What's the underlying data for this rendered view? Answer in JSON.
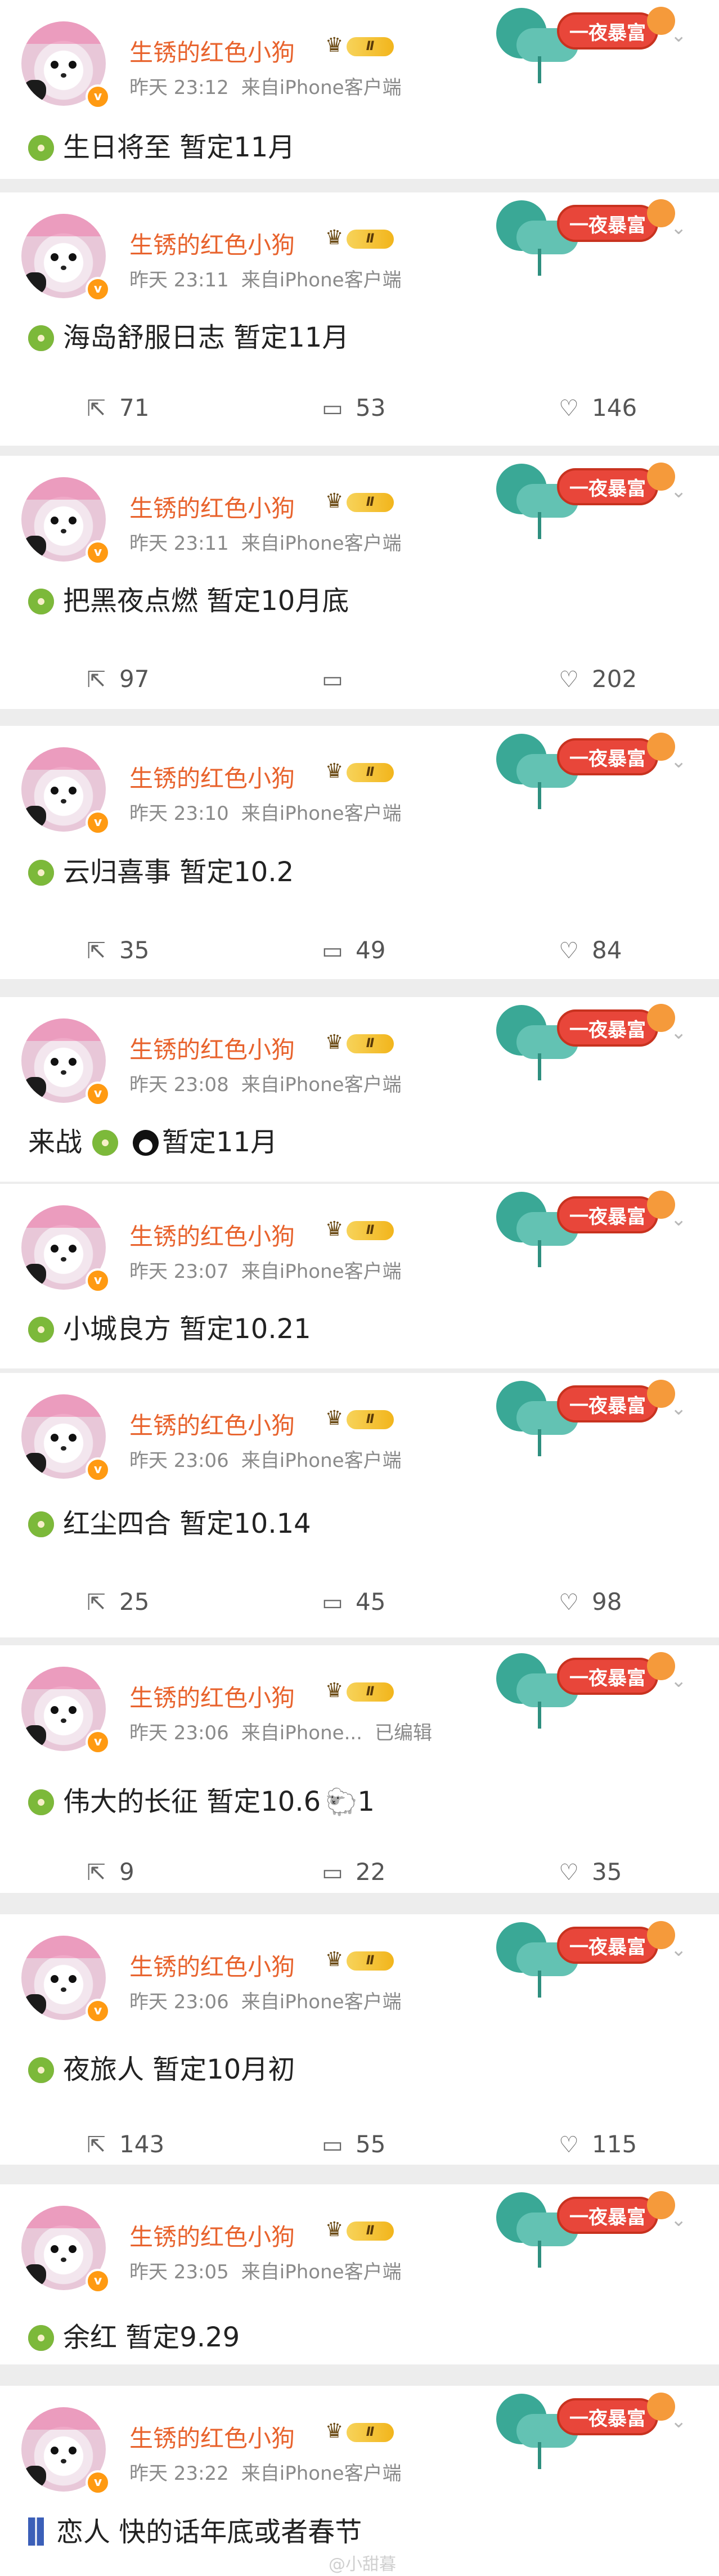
{
  "ui": {
    "accent": "#e8632d",
    "chip_color": "#e8463a",
    "page_bg": "#ededed"
  },
  "posts": [
    {
      "username": "生锈的红色小狗",
      "level": "Ⅱ",
      "badge": "v",
      "time": "昨天 23:12",
      "source": "来自iPhone客户端",
      "edited": "",
      "deco_text": "一夜暴富",
      "lead_icon": "kiwi-icon",
      "text": "生日将至 暂定11月",
      "trail": "",
      "share": "",
      "comments": "",
      "likes": ""
    },
    {
      "username": "生锈的红色小狗",
      "level": "Ⅱ",
      "badge": "v",
      "time": "昨天 23:11",
      "source": "来自iPhone客户端",
      "edited": "",
      "deco_text": "一夜暴富",
      "lead_icon": "kiwi-icon",
      "text": "海岛舒服日志 暂定11月",
      "trail": "",
      "share": "71",
      "comments": "53",
      "likes": "146"
    },
    {
      "username": "生锈的红色小狗",
      "level": "Ⅱ",
      "badge": "v",
      "time": "昨天 23:11",
      "source": "来自iPhone客户端",
      "edited": "",
      "deco_text": "一夜暴富",
      "lead_icon": "kiwi-icon",
      "text": "把黑夜点燃 暂定10月底",
      "trail": "",
      "share": "97",
      "comments": "",
      "likes": "202"
    },
    {
      "username": "生锈的红色小狗",
      "level": "Ⅱ",
      "badge": "v",
      "time": "昨天 23:10",
      "source": "来自iPhone客户端",
      "edited": "",
      "deco_text": "一夜暴富",
      "lead_icon": "kiwi-icon",
      "text": "云归喜事 暂定10.2",
      "trail": "",
      "share": "35",
      "comments": "49",
      "likes": "84"
    },
    {
      "username": "生锈的红色小狗",
      "level": "Ⅱ",
      "badge": "v",
      "time": "昨天 23:08",
      "source": "来自iPhone客户端",
      "edited": "",
      "deco_text": "一夜暴富",
      "lead_icon": "",
      "text": "来战",
      "trail": "暂定11月",
      "share": "",
      "comments": "",
      "likes": ""
    },
    {
      "username": "生锈的红色小狗",
      "level": "Ⅱ",
      "badge": "v",
      "time": "昨天 23:07",
      "source": "来自iPhone客户端",
      "edited": "",
      "deco_text": "一夜暴富",
      "lead_icon": "kiwi-icon",
      "text": "小城良方 暂定10.21",
      "trail": "",
      "share": "",
      "comments": "",
      "likes": ""
    },
    {
      "username": "生锈的红色小狗",
      "level": "Ⅱ",
      "badge": "v",
      "time": "昨天 23:06",
      "source": "来自iPhone客户端",
      "edited": "",
      "deco_text": "一夜暴富",
      "lead_icon": "kiwi-icon",
      "text": "红尘四合 暂定10.14",
      "trail": "",
      "share": "25",
      "comments": "45",
      "likes": "98"
    },
    {
      "username": "生锈的红色小狗",
      "level": "Ⅱ",
      "badge": "v",
      "time": "昨天 23:06",
      "source": "来自iPhone...",
      "edited": "已编辑",
      "deco_text": "一夜暴富",
      "lead_icon": "kiwi-icon",
      "text": "伟大的长征 暂定10.6",
      "trail": "1",
      "share": "9",
      "comments": "22",
      "likes": "35"
    },
    {
      "username": "生锈的红色小狗",
      "level": "Ⅱ",
      "badge": "v",
      "time": "昨天 23:06",
      "source": "来自iPhone客户端",
      "edited": "",
      "deco_text": "一夜暴富",
      "lead_icon": "kiwi-icon",
      "text": "夜旅人 暂定10月初",
      "trail": "",
      "share": "143",
      "comments": "55",
      "likes": "115"
    },
    {
      "username": "生锈的红色小狗",
      "level": "Ⅱ",
      "badge": "v",
      "time": "昨天 23:05",
      "source": "来自iPhone客户端",
      "edited": "",
      "deco_text": "一夜暴富",
      "lead_icon": "kiwi-icon",
      "text": "余红 暂定9.29",
      "trail": "",
      "share": "",
      "comments": "",
      "likes": ""
    },
    {
      "username": "生锈的红色小狗",
      "level": "Ⅱ",
      "badge": "v",
      "time": "昨天 23:22",
      "source": "来自iPhone客户端",
      "edited": "",
      "deco_text": "一夜暴富",
      "lead_icon": "jeans-icon",
      "text": "恋人 快的话年底或者春节",
      "trail": "",
      "share": "",
      "comments": "",
      "likes": ""
    }
  ],
  "watermark": "@小甜暮"
}
